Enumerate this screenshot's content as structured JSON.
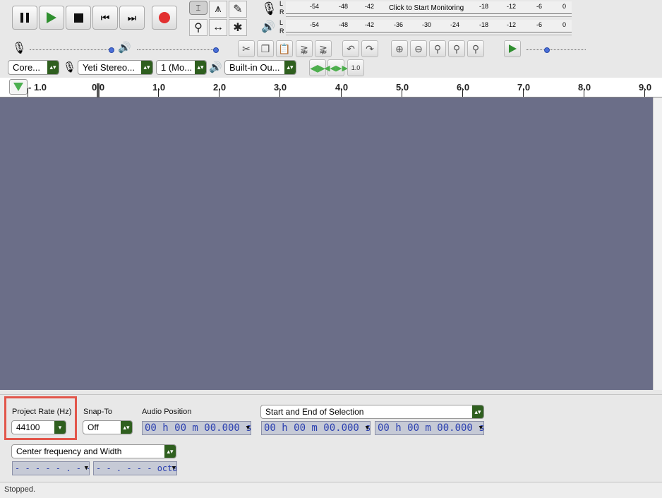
{
  "meters": {
    "rec_ticks": [
      "-54",
      "-48",
      "-42",
      "-18",
      "-12",
      "-6",
      "0"
    ],
    "rec_click_text": "Click to Start Monitoring",
    "play_ticks": [
      "-54",
      "-48",
      "-42",
      "-36",
      "-30",
      "-24",
      "-18",
      "-12",
      "-6",
      "0"
    ],
    "lr_l": "L",
    "lr_r": "R"
  },
  "devices": {
    "host": "Core...",
    "input_device": "Yeti Stereo...",
    "channels": "1 (Mo...",
    "output_device": "Built-in Ou..."
  },
  "ruler": {
    "labels": [
      "- 1.0",
      "0.0",
      "1.0",
      "2.0",
      "3.0",
      "4.0",
      "5.0",
      "6.0",
      "7.0",
      "8.0",
      "9.0"
    ]
  },
  "selection_toolbar": {
    "project_rate_label": "Project Rate (Hz)",
    "project_rate_value": "44100",
    "snap_to_label": "Snap-To",
    "snap_to_value": "Off",
    "audio_position_label": "Audio Position",
    "audio_position_value": "00 h 00 m 00.000 s",
    "selection_mode": "Start and End of Selection",
    "selection_start": "00 h 00 m 00.000 s",
    "selection_end": "00 h 00 m 00.000 s",
    "spectral_mode": "Center frequency and Width",
    "frequency_value": "- - - - - . - -  Hz",
    "width_value": "- - . - - -  octaves"
  },
  "play_at_speed": {
    "speed_label": "1.0"
  },
  "status": {
    "text": "Stopped."
  },
  "colors": {
    "track_bg": "#6b6e88",
    "highlight": "#e2564b",
    "record": "#e23030",
    "play": "#2f8f2f"
  }
}
